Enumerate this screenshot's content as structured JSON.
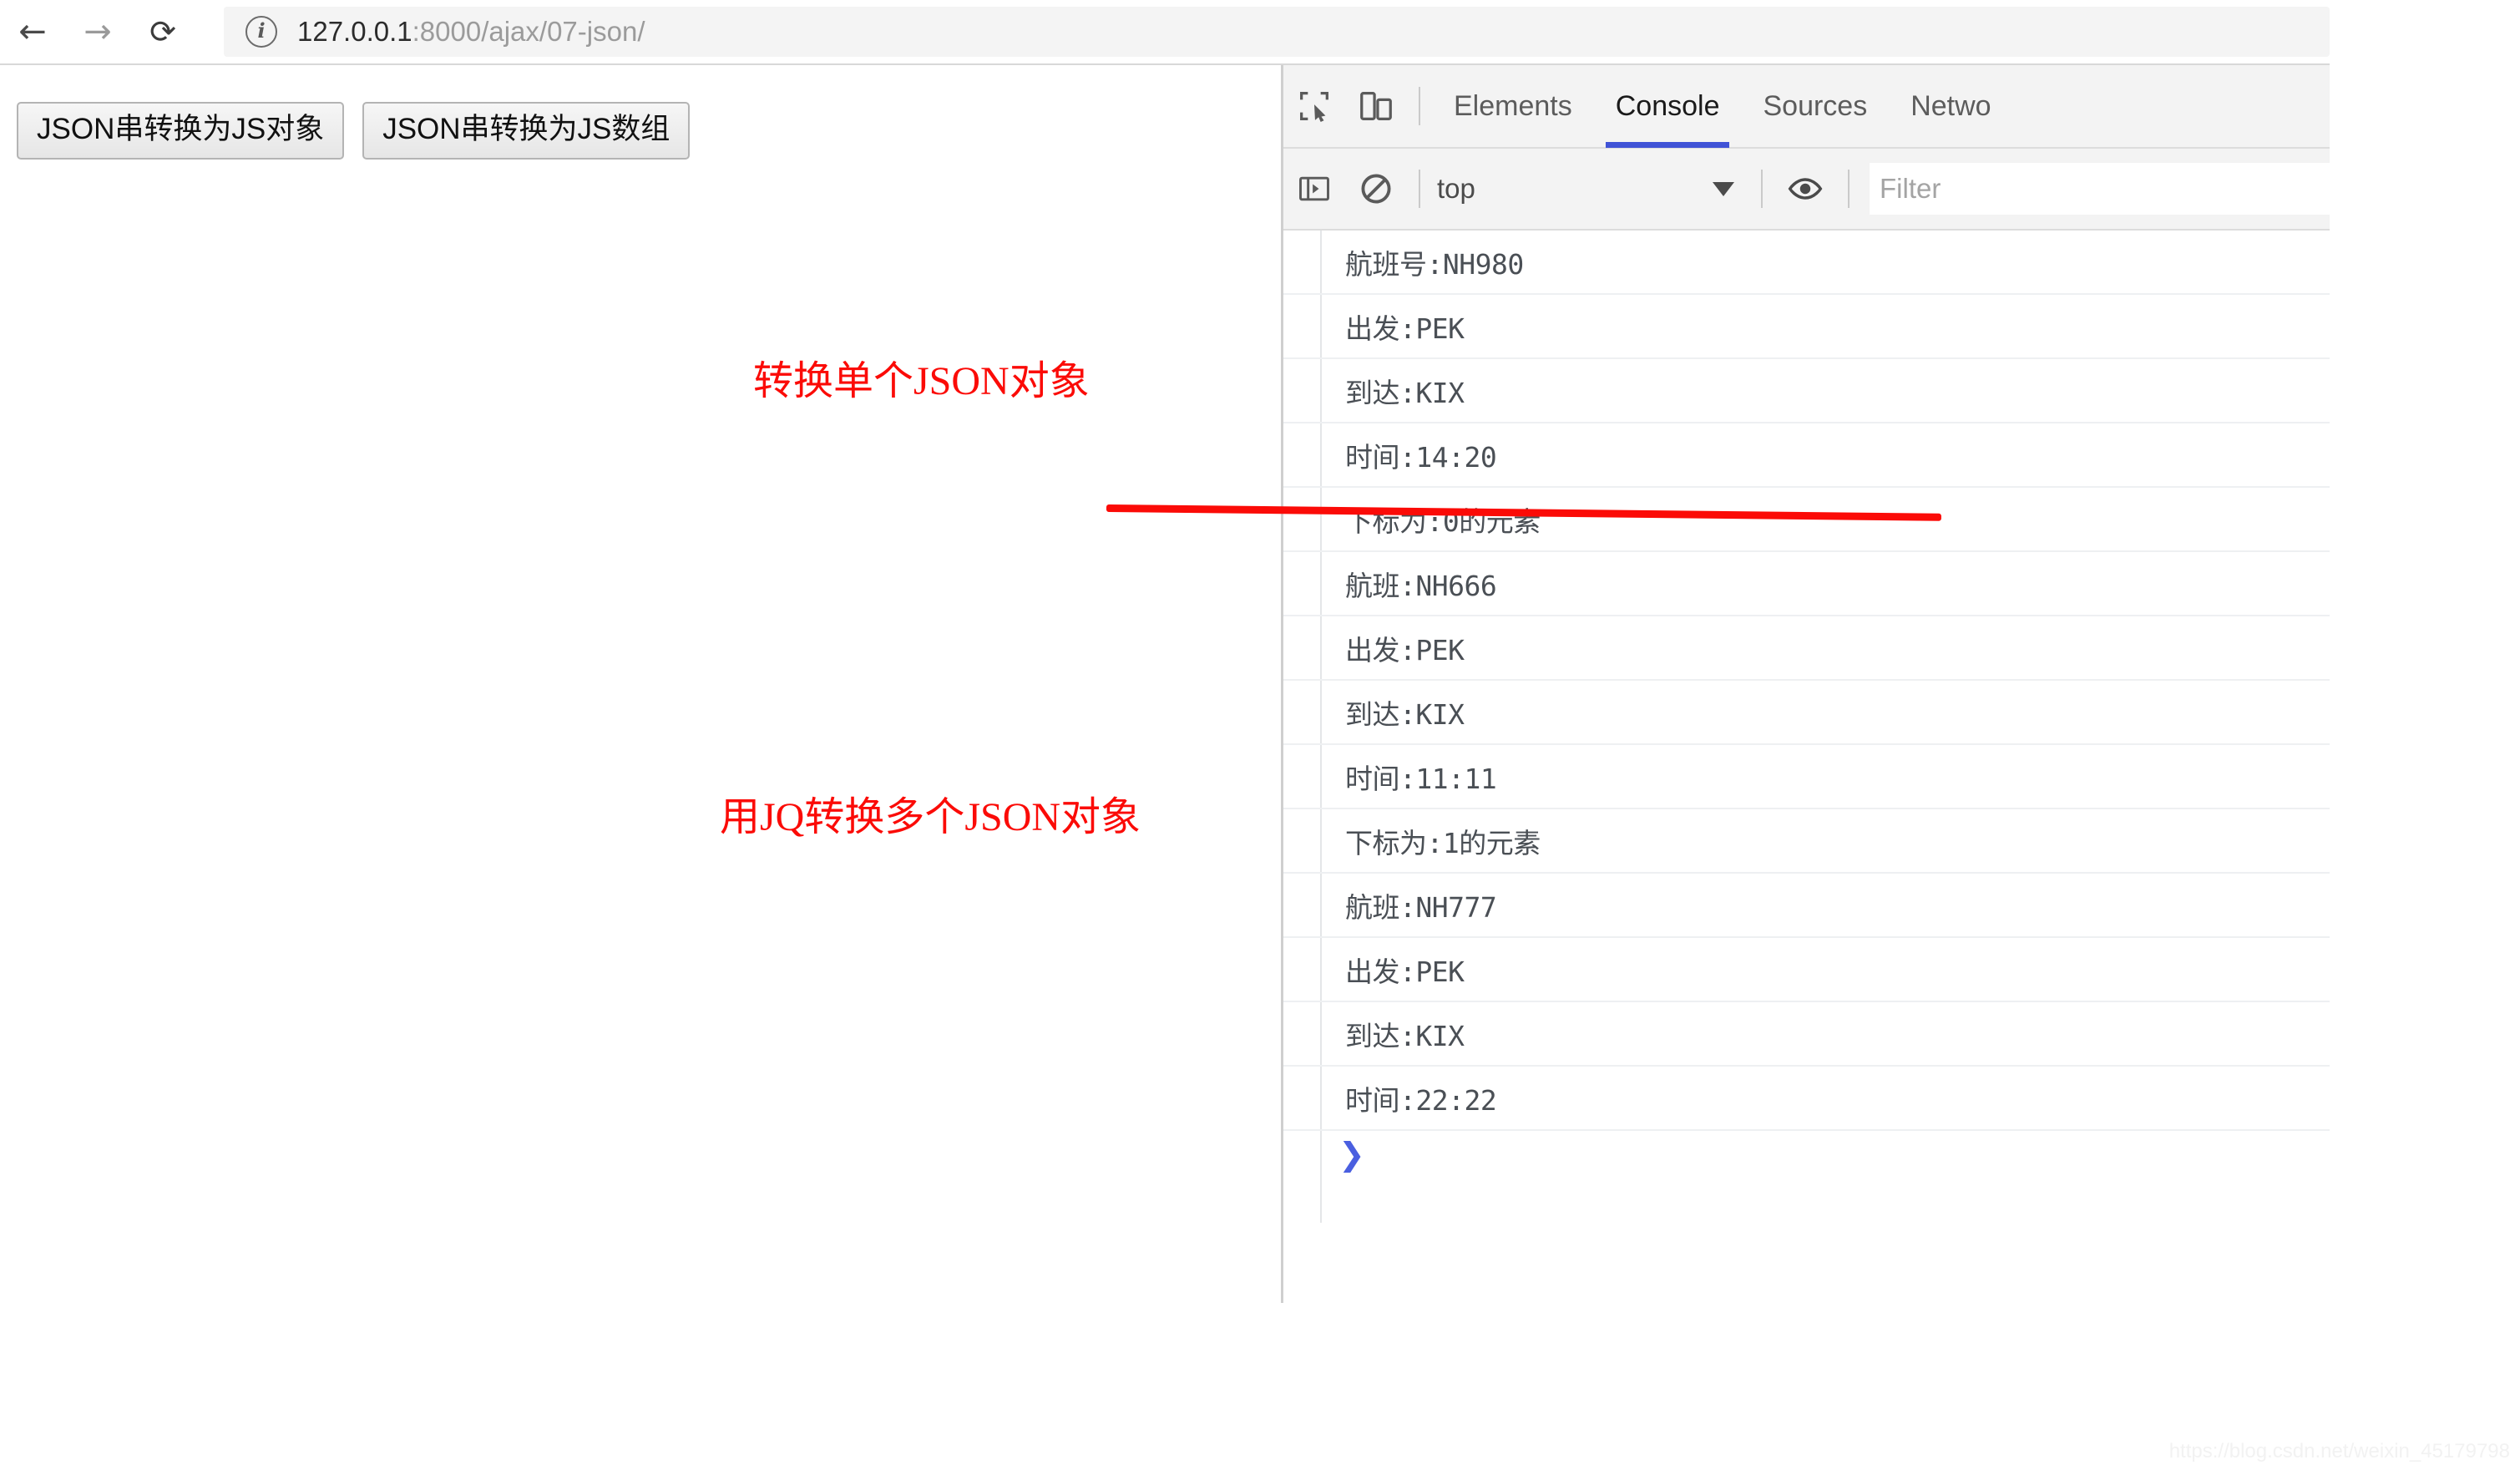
{
  "browser": {
    "back_label": "←",
    "forward_label": "→",
    "reload_label": "⟳",
    "site_info_label": "i",
    "url_host": "127.0.0.1",
    "url_rest": ":8000/ajax/07-json/"
  },
  "page": {
    "buttons": [
      {
        "label": "JSON串转换为JS对象"
      },
      {
        "label": "JSON串转换为JS数组"
      }
    ],
    "annotations": [
      {
        "text": "转换单个JSON对象"
      },
      {
        "text": "用JQ转换多个JSON对象"
      }
    ],
    "accent_red": "#fb0b07"
  },
  "devtools": {
    "toolbar_icons": [
      {
        "name": "inspect-element-icon"
      },
      {
        "name": "device-toolbar-icon"
      }
    ],
    "tabs": [
      {
        "label": "Elements",
        "active": false
      },
      {
        "label": "Console",
        "active": true
      },
      {
        "label": "Sources",
        "active": false
      },
      {
        "label": "Netwo",
        "active": false
      }
    ],
    "active_tab_underline_color": "#4053d6",
    "filterbar": {
      "sidebar_toggle_icon": "sidebar-toggle-icon",
      "clear_console_icon": "clear-console-icon",
      "context": "top",
      "eye_icon": "live-expression-eye-icon",
      "filter_placeholder": "Filter",
      "filter_value": ""
    },
    "console_lines": [
      "航班号:NH980",
      "出发:PEK",
      "到达:KIX",
      "时间:14:20",
      "下标为:0的元素",
      "航班:NH666",
      "出发:PEK",
      "到达:KIX",
      "时间:11:11",
      "下标为:1的元素",
      "航班:NH777",
      "出发:PEK",
      "到达:KIX",
      "时间:22:22"
    ],
    "prompt_symbol": "❯"
  },
  "watermark": "https://blog.csdn.net/weixin_45179798"
}
